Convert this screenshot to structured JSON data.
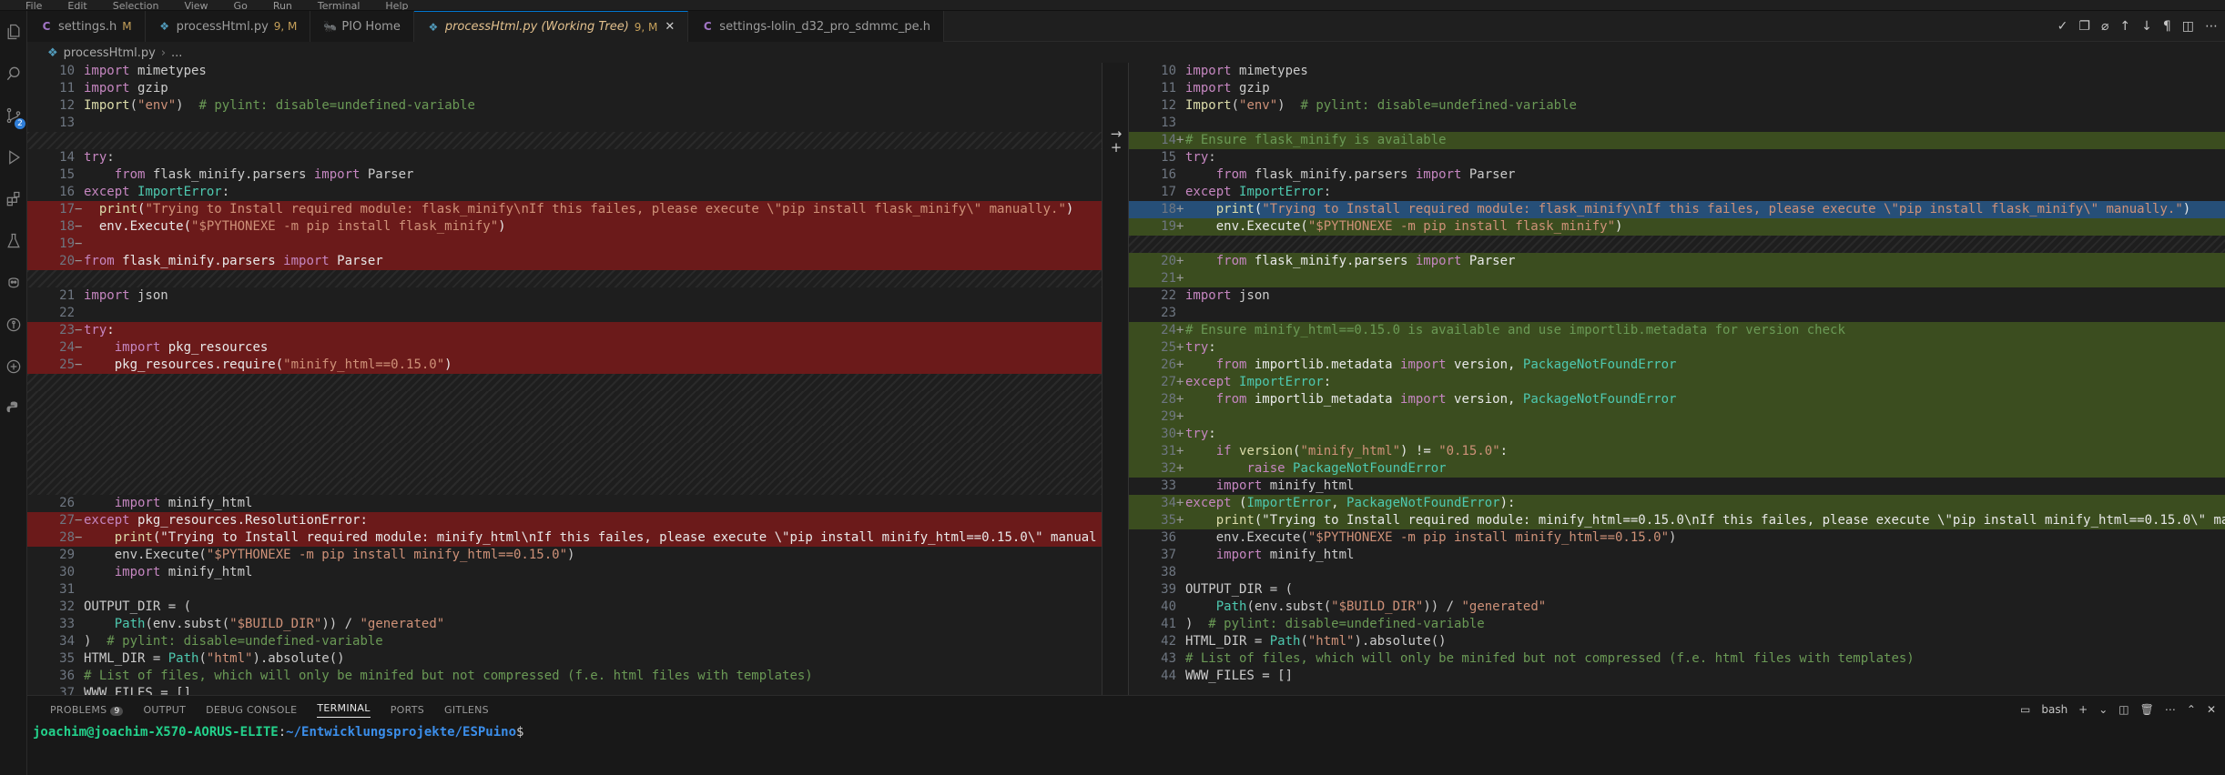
{
  "menu": {
    "items": [
      "File",
      "Edit",
      "Selection",
      "View",
      "Go",
      "Run",
      "Terminal",
      "Help"
    ]
  },
  "tabs": [
    {
      "icon": "C",
      "label": "settings.h",
      "mod": "M",
      "active": false
    },
    {
      "icon": "py",
      "label": "processHtml.py",
      "mod": "9, M",
      "active": false
    },
    {
      "icon": "pio",
      "label": "PIO Home",
      "mod": "",
      "active": false
    },
    {
      "icon": "py",
      "label": "processHtml.py (Working Tree)",
      "mod": "9, M",
      "active": true
    },
    {
      "icon": "C",
      "label": "settings-lolin_d32_pro_sdmmc_pe.h",
      "mod": "",
      "active": false
    }
  ],
  "breadcrumb": {
    "file": "processHtml.py",
    "more": "..."
  },
  "activity": {
    "scm_badge": "2"
  },
  "diff": {
    "left": [
      {
        "n": "10",
        "m": "",
        "t": "plain",
        "c": "import mimetypes"
      },
      {
        "n": "11",
        "m": "",
        "t": "plain",
        "c": "import gzip"
      },
      {
        "n": "12",
        "m": "",
        "t": "plain",
        "c": "Import(\"env\")  # pylint: disable=undefined-variable"
      },
      {
        "n": "13",
        "m": "",
        "t": "plain",
        "c": ""
      },
      {
        "n": "",
        "m": "",
        "t": "hatch",
        "c": ""
      },
      {
        "n": "14",
        "m": "",
        "t": "plain",
        "c": "try:"
      },
      {
        "n": "15",
        "m": "",
        "t": "plain",
        "c": "    from flask_minify.parsers import Parser"
      },
      {
        "n": "16",
        "m": "",
        "t": "plain",
        "c": "except ImportError:"
      },
      {
        "n": "17",
        "m": "−",
        "t": "del",
        "c": "  print(\"Trying to Install required module: flask_minify\\nIf this failes, please execute \\\"pip install flask_minify\\\" manually.\")"
      },
      {
        "n": "18",
        "m": "−",
        "t": "del",
        "c": "  env.Execute(\"$PYTHONEXE -m pip install flask_minify\")"
      },
      {
        "n": "19",
        "m": "−",
        "t": "del",
        "c": ""
      },
      {
        "n": "20",
        "m": "−",
        "t": "del",
        "c": "from flask_minify.parsers import Parser"
      },
      {
        "n": "",
        "m": "",
        "t": "hatch",
        "c": ""
      },
      {
        "n": "21",
        "m": "",
        "t": "plain",
        "c": "import json"
      },
      {
        "n": "22",
        "m": "",
        "t": "plain",
        "c": ""
      },
      {
        "n": "23",
        "m": "−",
        "t": "del",
        "c": "try:"
      },
      {
        "n": "24",
        "m": "−",
        "t": "del",
        "c": "    import pkg_resources"
      },
      {
        "n": "25",
        "m": "−",
        "t": "del",
        "c": "    pkg_resources.require(\"minify_html==0.15.0\")"
      },
      {
        "n": "",
        "m": "",
        "t": "hatch",
        "c": ""
      },
      {
        "n": "",
        "m": "",
        "t": "hatch",
        "c": ""
      },
      {
        "n": "",
        "m": "",
        "t": "hatch",
        "c": ""
      },
      {
        "n": "",
        "m": "",
        "t": "hatch",
        "c": ""
      },
      {
        "n": "",
        "m": "",
        "t": "hatch",
        "c": ""
      },
      {
        "n": "",
        "m": "",
        "t": "hatch",
        "c": ""
      },
      {
        "n": "",
        "m": "",
        "t": "hatch",
        "c": ""
      },
      {
        "n": "26",
        "m": "",
        "t": "plain",
        "c": "    import minify_html"
      },
      {
        "n": "27",
        "m": "−",
        "t": "del",
        "c": "except pkg_resources.ResolutionError:"
      },
      {
        "n": "28",
        "m": "−",
        "t": "del",
        "c": "    print(\"Trying to Install required module: minify_html\\nIf this failes, please execute \\\"pip install minify_html==0.15.0\\\" manual"
      },
      {
        "n": "29",
        "m": "",
        "t": "plain",
        "c": "    env.Execute(\"$PYTHONEXE -m pip install minify_html==0.15.0\")"
      },
      {
        "n": "30",
        "m": "",
        "t": "plain",
        "c": "    import minify_html"
      },
      {
        "n": "31",
        "m": "",
        "t": "plain",
        "c": ""
      },
      {
        "n": "32",
        "m": "",
        "t": "plain",
        "c": "OUTPUT_DIR = ("
      },
      {
        "n": "33",
        "m": "",
        "t": "plain",
        "c": "    Path(env.subst(\"$BUILD_DIR\")) / \"generated\""
      },
      {
        "n": "34",
        "m": "",
        "t": "plain",
        "c": ")  # pylint: disable=undefined-variable"
      },
      {
        "n": "35",
        "m": "",
        "t": "plain",
        "c": "HTML_DIR = Path(\"html\").absolute()"
      },
      {
        "n": "36",
        "m": "",
        "t": "plain",
        "c": "# List of files, which will only be minifed but not compressed (f.e. html files with templates)"
      },
      {
        "n": "37",
        "m": "",
        "t": "plain",
        "c": "WWW_FILES = []"
      }
    ],
    "right": [
      {
        "n": "10",
        "m": "",
        "t": "plain",
        "c": "import mimetypes"
      },
      {
        "n": "11",
        "m": "",
        "t": "plain",
        "c": "import gzip"
      },
      {
        "n": "12",
        "m": "",
        "t": "plain",
        "c": "Import(\"env\")  # pylint: disable=undefined-variable"
      },
      {
        "n": "13",
        "m": "",
        "t": "plain",
        "c": ""
      },
      {
        "n": "14",
        "m": "+",
        "t": "add",
        "c": "# Ensure flask_minify is available"
      },
      {
        "n": "15",
        "m": "",
        "t": "plain",
        "c": "try:"
      },
      {
        "n": "16",
        "m": "",
        "t": "plain",
        "c": "    from flask_minify.parsers import Parser"
      },
      {
        "n": "17",
        "m": "",
        "t": "plain",
        "c": "except ImportError:"
      },
      {
        "n": "18",
        "m": "+",
        "t": "addhl",
        "c": "    print(\"Trying to Install required module: flask_minify\\nIf this failes, please execute \\\"pip install flask_minify\\\" manually.\")"
      },
      {
        "n": "19",
        "m": "+",
        "t": "add",
        "c": "    env.Execute(\"$PYTHONEXE -m pip install flask_minify\")"
      },
      {
        "n": "",
        "m": "",
        "t": "hatch",
        "c": ""
      },
      {
        "n": "20",
        "m": "+",
        "t": "add",
        "c": "    from flask_minify.parsers import Parser"
      },
      {
        "n": "21",
        "m": "+",
        "t": "add",
        "c": ""
      },
      {
        "n": "22",
        "m": "",
        "t": "plain",
        "c": "import json"
      },
      {
        "n": "23",
        "m": "",
        "t": "plain",
        "c": ""
      },
      {
        "n": "24",
        "m": "+",
        "t": "add",
        "c": "# Ensure minify_html==0.15.0 is available and use importlib.metadata for version check"
      },
      {
        "n": "25",
        "m": "+",
        "t": "add",
        "c": "try:"
      },
      {
        "n": "26",
        "m": "+",
        "t": "add",
        "c": "    from importlib.metadata import version, PackageNotFoundError"
      },
      {
        "n": "27",
        "m": "+",
        "t": "add",
        "c": "except ImportError:"
      },
      {
        "n": "28",
        "m": "+",
        "t": "add",
        "c": "    from importlib_metadata import version, PackageNotFoundError"
      },
      {
        "n": "29",
        "m": "+",
        "t": "add",
        "c": ""
      },
      {
        "n": "30",
        "m": "+",
        "t": "add",
        "c": "try:"
      },
      {
        "n": "31",
        "m": "+",
        "t": "add",
        "c": "    if version(\"minify_html\") != \"0.15.0\":"
      },
      {
        "n": "32",
        "m": "+",
        "t": "add",
        "c": "        raise PackageNotFoundError"
      },
      {
        "n": "33",
        "m": "",
        "t": "plain",
        "c": "    import minify_html"
      },
      {
        "n": "34",
        "m": "+",
        "t": "add",
        "c": "except (ImportError, PackageNotFoundError):"
      },
      {
        "n": "35",
        "m": "+",
        "t": "add",
        "c": "    print(\"Trying to Install required module: minify_html==0.15.0\\nIf this failes, please execute \\\"pip install minify_html==0.15.0\\\" ma"
      },
      {
        "n": "36",
        "m": "",
        "t": "plain",
        "c": "    env.Execute(\"$PYTHONEXE -m pip install minify_html==0.15.0\")"
      },
      {
        "n": "37",
        "m": "",
        "t": "plain",
        "c": "    import minify_html"
      },
      {
        "n": "38",
        "m": "",
        "t": "plain",
        "c": ""
      },
      {
        "n": "39",
        "m": "",
        "t": "plain",
        "c": "OUTPUT_DIR = ("
      },
      {
        "n": "40",
        "m": "",
        "t": "plain",
        "c": "    Path(env.subst(\"$BUILD_DIR\")) / \"generated\""
      },
      {
        "n": "41",
        "m": "",
        "t": "plain",
        "c": ")  # pylint: disable=undefined-variable"
      },
      {
        "n": "42",
        "m": "",
        "t": "plain",
        "c": "HTML_DIR = Path(\"html\").absolute()"
      },
      {
        "n": "43",
        "m": "",
        "t": "plain",
        "c": "# List of files, which will only be minifed but not compressed (f.e. html files with templates)"
      },
      {
        "n": "44",
        "m": "",
        "t": "plain",
        "c": "WWW_FILES = []"
      }
    ]
  },
  "panel": {
    "tabs": [
      "PROBLEMS",
      "OUTPUT",
      "DEBUG CONSOLE",
      "TERMINAL",
      "PORTS",
      "GITLENS"
    ],
    "problems_count": "9",
    "active": "TERMINAL",
    "shell": "bash"
  },
  "terminal": {
    "user": "joachim@joachim-X570-AORUS-ELITE",
    "sep": ":",
    "path": "~/Entwicklungsprojekte/ESPuino",
    "prompt": "$"
  }
}
